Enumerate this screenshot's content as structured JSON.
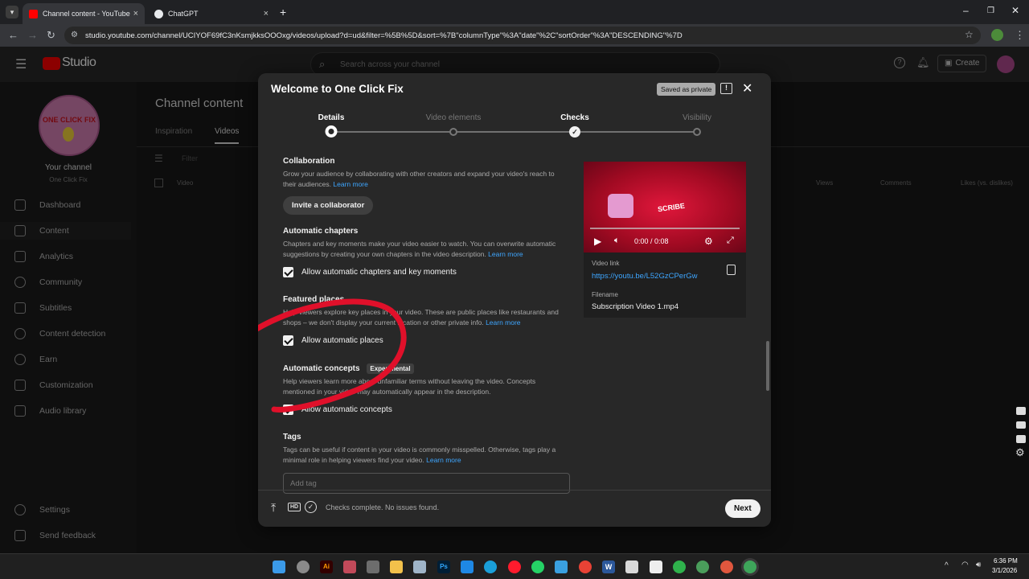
{
  "browser": {
    "tabs": [
      {
        "title": "Channel content - YouTube Stu",
        "active": true
      },
      {
        "title": "ChatGPT",
        "active": false
      }
    ],
    "url": "studio.youtube.com/channel/UCIYOF69fC3nKsmjkksOOOxg/videos/upload?d=ud&filter=%5B%5D&sort=%7B\"columnType\"%3A\"date\"%2C\"sortOrder\"%3A\"DESCENDING\"%7D"
  },
  "studio": {
    "logo_text": "Studio",
    "search_placeholder": "Search across your channel",
    "create_label": "Create",
    "page_title": "Channel content",
    "tabs": [
      "Inspiration",
      "Videos"
    ],
    "filter_placeholder": "Filter",
    "table_headers": {
      "video": "Video",
      "views": "Views",
      "comments": "Comments",
      "likes": "Likes (vs. dislikes)"
    },
    "channel": {
      "label": "Your channel",
      "name": "One Click Fix",
      "avatar_text": "ONE CLICK FIX"
    },
    "sidebar": [
      {
        "label": "Dashboard",
        "icon": "dashboard-icon"
      },
      {
        "label": "Content",
        "icon": "content-icon"
      },
      {
        "label": "Analytics",
        "icon": "analytics-icon"
      },
      {
        "label": "Community",
        "icon": "community-icon"
      },
      {
        "label": "Subtitles",
        "icon": "subtitles-icon"
      },
      {
        "label": "Content detection",
        "icon": "content-detection-icon"
      },
      {
        "label": "Earn",
        "icon": "earn-icon"
      },
      {
        "label": "Customization",
        "icon": "customization-icon"
      },
      {
        "label": "Audio library",
        "icon": "audio-library-icon"
      }
    ],
    "sidebar_bottom": [
      {
        "label": "Settings",
        "icon": "settings-icon"
      },
      {
        "label": "Send feedback",
        "icon": "feedback-icon"
      }
    ]
  },
  "dialog": {
    "title": "Welcome to One Click Fix",
    "saved_badge": "Saved as private",
    "steps": [
      {
        "label": "Details",
        "state": "active"
      },
      {
        "label": "Video elements",
        "state": "todo"
      },
      {
        "label": "Checks",
        "state": "done"
      },
      {
        "label": "Visibility",
        "state": "todo"
      }
    ],
    "collaboration": {
      "title": "Collaboration",
      "desc": "Grow your audience by collaborating with other creators and expand your video's reach to their audiences.",
      "link": "Learn more",
      "button": "Invite a collaborator"
    },
    "chapters": {
      "title": "Automatic chapters",
      "desc": "Chapters and key moments make your video easier to watch. You can overwrite automatic suggestions by creating your own chapters in the video description.",
      "link": "Learn more",
      "checkbox": "Allow automatic chapters and key moments"
    },
    "places": {
      "title": "Featured places",
      "desc": "Help viewers explore key places in your video. These are public places like restaurants and shops – we don't display your current location or other private info.",
      "link": "Learn more",
      "checkbox": "Allow automatic places"
    },
    "concepts": {
      "title": "Automatic concepts",
      "badge": "Experimental",
      "desc": "Help viewers learn more about unfamiliar terms without leaving the video. Concepts mentioned in your video may automatically appear in the description.",
      "checkbox": "Allow automatic concepts"
    },
    "tags": {
      "title": "Tags",
      "desc": "Tags can be useful if content in your video is commonly misspelled. Otherwise, tags play a minimal role in helping viewers find your video.",
      "link": "Learn more",
      "placeholder": "Add tag"
    },
    "preview": {
      "time": "0:00 / 0:08",
      "thumb_text": "SCRIBE",
      "video_link_label": "Video link",
      "video_link": "https://youtu.be/L52GzCPerGw",
      "filename_label": "Filename",
      "filename": "Subscription Video 1.mp4"
    },
    "footer": {
      "hd_badge": "HD",
      "status": "Checks complete. No issues found.",
      "next": "Next"
    }
  },
  "taskbar": {
    "time": "6:36 PM",
    "date": "3/1/2026"
  },
  "colors": {
    "accent_red": "#e8112d",
    "link_blue": "#3ea6ff",
    "annotation_red": "#e0102a"
  }
}
